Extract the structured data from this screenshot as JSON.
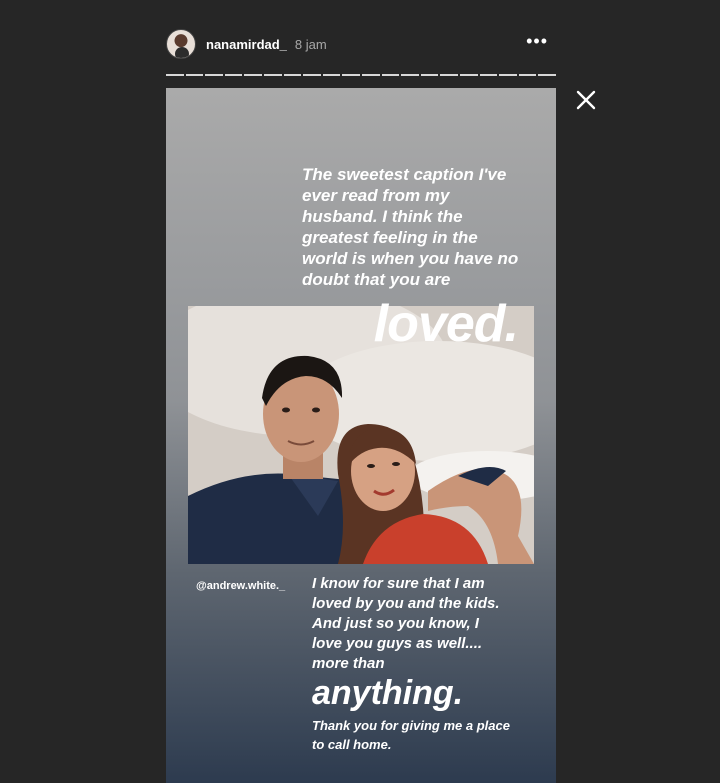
{
  "header": {
    "username": "nanamirdad_",
    "time": "8 jam",
    "more_label": "•••"
  },
  "progress": {
    "segments": 20,
    "color": "#d7d7d7"
  },
  "icons": {
    "close": "close-icon",
    "more": "more-options-icon",
    "avatar": "avatar"
  },
  "story": {
    "caption_top": "The sweetest caption I've ever read from my husband. I think the greatest feeling in the world is when you have no doubt that you are",
    "big_word_1": "loved.",
    "mention": "@andrew.white._",
    "caption_bottom": "I know for sure that I am loved by you and the kids. And just so you know, I love you guys as well.... more than",
    "big_word_2": "anything.",
    "caption_end": "Thank you for giving me a place to call home."
  },
  "colors": {
    "background": "#262626",
    "text": "#ffffff",
    "muted": "#a8a8a8"
  }
}
